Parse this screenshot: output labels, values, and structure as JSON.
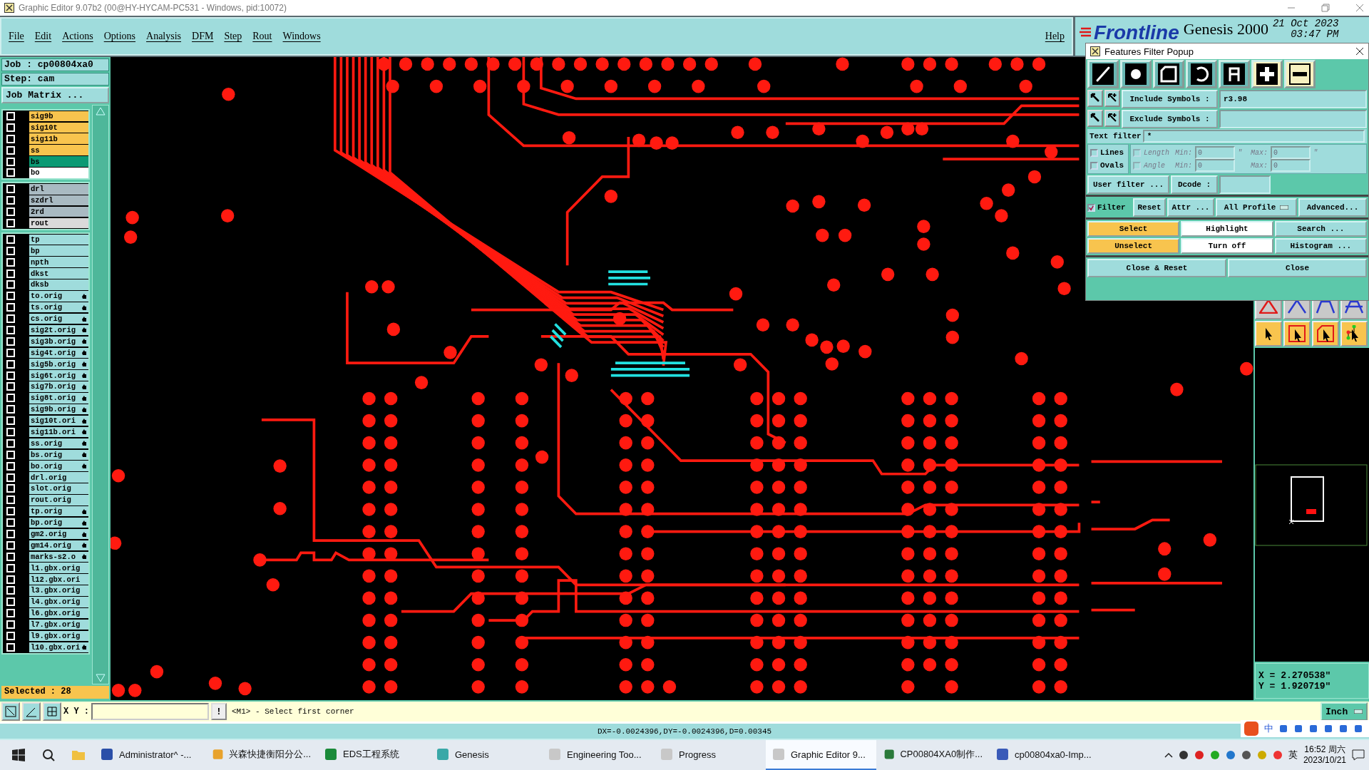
{
  "window": {
    "title": "Graphic Editor 9.07b2 (00@HY-HYCAM-PC531 - Windows, pid:10072)"
  },
  "menu": [
    {
      "label": "File"
    },
    {
      "label": "Edit"
    },
    {
      "label": "Actions"
    },
    {
      "label": "Options"
    },
    {
      "label": "Analysis"
    },
    {
      "label": "DFM"
    },
    {
      "label": "Step"
    },
    {
      "label": "Rout"
    },
    {
      "label": "Windows"
    }
  ],
  "help": "Help",
  "brand": {
    "logo": "Frontline",
    "product": "Genesis 2000",
    "date": "21 Oct 2023",
    "time": "03:47 PM"
  },
  "job": {
    "job": "Job  : cp00804xa0",
    "step": "Step: cam",
    "matrix_button": "Job Matrix ..."
  },
  "layer_groups": [
    [
      {
        "name": "sig9b",
        "color": "#f8c44e",
        "linked": false,
        "checked": false
      },
      {
        "name": "sig10t",
        "color": "#f8c44e",
        "linked": false,
        "checked": false
      },
      {
        "name": "sig11b",
        "color": "#f8c44e",
        "linked": false,
        "checked": false
      },
      {
        "name": "ss",
        "color": "#f8c44e",
        "linked": false,
        "checked": false
      },
      {
        "name": "bs",
        "color": "#0b9a74",
        "linked": false,
        "checked": false
      },
      {
        "name": "bo",
        "color": "#ffffff",
        "linked": false,
        "checked": false
      }
    ],
    [
      {
        "name": "drl",
        "color": "#a9bac2",
        "linked": false,
        "checked": false
      },
      {
        "name": "szdrl",
        "color": "#a9bac2",
        "linked": false,
        "checked": false
      },
      {
        "name": "2rd",
        "color": "#a9bac2",
        "linked": false,
        "checked": false
      },
      {
        "name": "rout",
        "color": "#dadada",
        "linked": false,
        "checked": false
      }
    ],
    [
      {
        "name": "tp",
        "color": "#9fdcdc",
        "linked": false,
        "checked": false
      },
      {
        "name": "bp",
        "color": "#9fdcdc",
        "linked": false,
        "checked": false
      },
      {
        "name": "npth",
        "color": "#9fdcdc",
        "linked": false,
        "checked": false
      },
      {
        "name": "dkst",
        "color": "#9fdcdc",
        "linked": false,
        "checked": false
      },
      {
        "name": "dksb",
        "color": "#9fdcdc",
        "linked": false,
        "checked": false
      },
      {
        "name": "to.orig",
        "color": "#9fdcdc",
        "linked": true,
        "checked": false
      },
      {
        "name": "ts.orig",
        "color": "#9fdcdc",
        "linked": true,
        "checked": false
      },
      {
        "name": "cs.orig",
        "color": "#9fdcdc",
        "linked": true,
        "checked": false
      },
      {
        "name": "sig2t.orig",
        "color": "#9fdcdc",
        "linked": true,
        "checked": false
      },
      {
        "name": "sig3b.orig",
        "color": "#9fdcdc",
        "linked": true,
        "checked": false
      },
      {
        "name": "sig4t.orig",
        "color": "#9fdcdc",
        "linked": true,
        "checked": false
      },
      {
        "name": "sig5b.orig",
        "color": "#9fdcdc",
        "linked": true,
        "checked": false
      },
      {
        "name": "sig6t.orig",
        "color": "#9fdcdc",
        "linked": true,
        "checked": false
      },
      {
        "name": "sig7b.orig",
        "color": "#9fdcdc",
        "linked": true,
        "checked": false
      },
      {
        "name": "sig8t.orig",
        "color": "#9fdcdc",
        "linked": true,
        "checked": false
      },
      {
        "name": "sig9b.orig",
        "color": "#9fdcdc",
        "linked": true,
        "checked": false
      },
      {
        "name": "sig10t.ori",
        "color": "#9fdcdc",
        "linked": true,
        "checked": false
      },
      {
        "name": "sig11b.ori",
        "color": "#9fdcdc",
        "linked": true,
        "checked": false
      },
      {
        "name": "ss.orig",
        "color": "#9fdcdc",
        "linked": true,
        "checked": false
      },
      {
        "name": "bs.orig",
        "color": "#9fdcdc",
        "linked": true,
        "checked": false
      },
      {
        "name": "bo.orig",
        "color": "#9fdcdc",
        "linked": true,
        "checked": false
      },
      {
        "name": "drl.orig",
        "color": "#9fdcdc",
        "linked": false,
        "checked": false
      },
      {
        "name": "slot.orig",
        "color": "#9fdcdc",
        "linked": false,
        "checked": false
      },
      {
        "name": "rout.orig",
        "color": "#9fdcdc",
        "linked": false,
        "checked": false
      },
      {
        "name": "tp.orig",
        "color": "#9fdcdc",
        "linked": true,
        "checked": false
      },
      {
        "name": "bp.orig",
        "color": "#9fdcdc",
        "linked": true,
        "checked": false
      },
      {
        "name": "gm2.orig",
        "color": "#9fdcdc",
        "linked": true,
        "checked": false
      },
      {
        "name": "gm14.orig",
        "color": "#9fdcdc",
        "linked": true,
        "checked": false
      },
      {
        "name": "marks-s2.o",
        "color": "#9fdcdc",
        "linked": true,
        "checked": false
      },
      {
        "name": "l1.gbx.orig",
        "color": "#9fdcdc",
        "linked": false,
        "checked": false
      },
      {
        "name": "l12.gbx.ori",
        "color": "#9fdcdc",
        "linked": false,
        "checked": false
      },
      {
        "name": "l3.gbx.orig",
        "color": "#9fdcdc",
        "linked": false,
        "checked": false
      },
      {
        "name": "l4.gbx.orig",
        "color": "#9fdcdc",
        "linked": false,
        "checked": false
      },
      {
        "name": "l6.gbx.orig",
        "color": "#9fdcdc",
        "linked": false,
        "checked": false
      },
      {
        "name": "l7.gbx.orig",
        "color": "#9fdcdc",
        "linked": false,
        "checked": false
      },
      {
        "name": "l9.gbx.orig",
        "color": "#9fdcdc",
        "linked": false,
        "checked": false
      },
      {
        "name": "l10.gbx.ori",
        "color": "#9fdcdc",
        "linked": true,
        "checked": false
      }
    ]
  ],
  "selected_count": "Selected : 28",
  "coordinates": {
    "x": "X = 2.270538\"",
    "y": "Y = 1.920719\""
  },
  "command_bar": {
    "xy_label": "X Y :",
    "alert": "!",
    "message": "<M1> - Select first corner",
    "units": "Inch"
  },
  "status": "DX=-0.0024396,DY=-0.0024396,D=0.00345",
  "filter_popup": {
    "title": "Features Filter Popup",
    "feature_types": [
      {
        "kind": "line"
      },
      {
        "kind": "pad"
      },
      {
        "kind": "surface"
      },
      {
        "kind": "arc"
      },
      {
        "kind": "text"
      },
      {
        "kind": "positive"
      },
      {
        "kind": "negative"
      }
    ],
    "include": {
      "label": "Include Symbols :",
      "value": "r3.98"
    },
    "exclude": {
      "label": "Exclude Symbols :"
    },
    "text_filter": {
      "label": "Text filter",
      "value": "*"
    },
    "shape_checks": [
      {
        "label": "Lines",
        "checked": false
      },
      {
        "label": "Ovals",
        "checked": false
      }
    ],
    "ranges": [
      {
        "label": "Length",
        "disabled": true,
        "min_label": "Min:",
        "min": "0",
        "max_label": "Max:",
        "max": "0",
        "unit": "\""
      },
      {
        "label": "Angle",
        "disabled": true,
        "min_label": "Min:",
        "min": "0",
        "max_label": "Max:",
        "max": "0"
      }
    ],
    "user_filter": "User filter ...",
    "dcode_label": "Dcode :",
    "filter": {
      "label": "Filter",
      "checked": true
    },
    "tools": [
      "Reset",
      "Attr ..."
    ],
    "profile": "All Profile",
    "advanced": "Advanced...",
    "actions": [
      {
        "label": "Select",
        "color": "#f8c44e"
      },
      {
        "label": "Highlight",
        "color": "#ffffff"
      },
      {
        "label": "Search ...",
        "color": "#9fdcdc"
      },
      {
        "label": "Unselect",
        "color": "#f8c44e"
      },
      {
        "label": "Turn off",
        "color": "#ffffff"
      },
      {
        "label": "Histogram ...",
        "color": "#9fdcdc"
      }
    ],
    "close_reset": "Close & Reset",
    "close": "Close"
  },
  "ime_bar": {
    "mode": "中"
  },
  "taskbar": {
    "items": [
      {
        "label": "Administrator^ -...",
        "selected": false
      },
      {
        "label": "兴森快捷衡阳分公...",
        "selected": false
      },
      {
        "label": "EDS工程系统",
        "selected": false
      },
      {
        "label": "Genesis",
        "selected": false
      },
      {
        "label": "Engineering Too...",
        "selected": false
      },
      {
        "label": "Progress",
        "selected": false
      },
      {
        "label": "Graphic Editor 9...",
        "selected": true
      },
      {
        "label": "CP00804XA0制作...",
        "selected": false
      },
      {
        "label": "cp00804xa0-Imp...",
        "selected": false
      }
    ],
    "input_mode": "英",
    "time": "16:52 周六",
    "date": "2023/10/21"
  }
}
